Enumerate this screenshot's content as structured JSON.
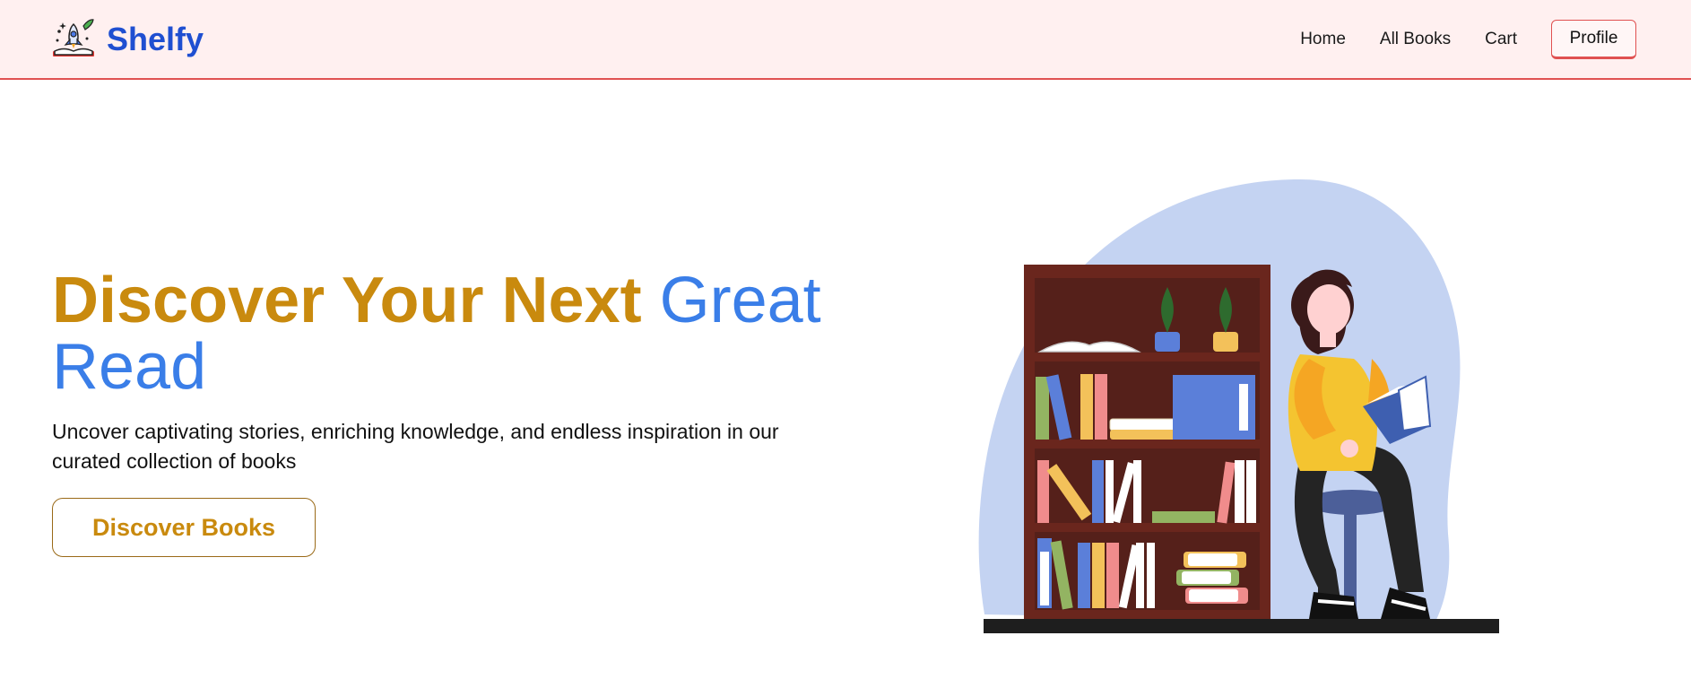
{
  "navbar": {
    "brand_name": "Shelfy",
    "logo_icon": "rocket-book-icon",
    "links": [
      "Home",
      "All Books",
      "Cart"
    ],
    "profile_label": "Profile"
  },
  "hero": {
    "title_part1": "Discover Your Next ",
    "title_part2": "Great Read",
    "subtitle": "Uncover captivating stories, enriching knowledge, and endless inspiration in our curated collection of books",
    "cta_label": "Discover Books",
    "illustration": "woman-reading-by-bookshelf-illustration"
  },
  "colors": {
    "brand_blue": "#1f4fd1",
    "accent_gold": "#c98a0e",
    "accent_blue": "#3a7ee8",
    "nav_bg": "#fff0f0",
    "nav_border": "#e05151"
  }
}
